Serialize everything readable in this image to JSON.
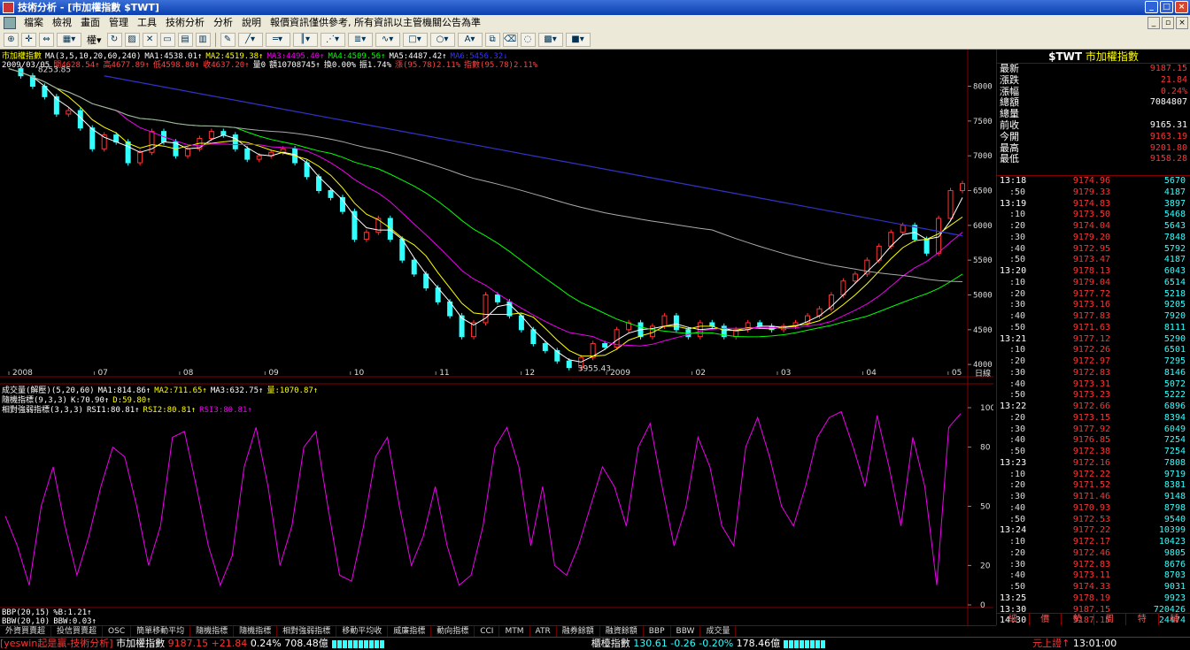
{
  "window": {
    "title": "技術分析 - [市加權指數 $TWT]"
  },
  "menu": [
    "檔案",
    "檢視",
    "畫面",
    "管理",
    "工具",
    "技術分析",
    "分析",
    "說明",
    "報價資訊僅供參考, 所有資訊以主管機關公告為準"
  ],
  "toolbar": {
    "weight_label": "權"
  },
  "info": {
    "line1": [
      {
        "t": "市加權指數",
        "c": "#ff0"
      },
      {
        "t": "MA(3,5,10,20,60,240)",
        "c": "#fff"
      },
      {
        "t": "MA1:4538.01↑",
        "c": "#fff"
      },
      {
        "t": "MA2:4519.38↑",
        "c": "#ff0"
      },
      {
        "t": "MA3:4495.40↑",
        "c": "#e0e"
      },
      {
        "t": "MA4:4509.56↑",
        "c": "#0f0"
      },
      {
        "t": "MA5:4487.42↑",
        "c": "#fff"
      },
      {
        "t": "MA6:5456.32↓",
        "c": "#33f"
      }
    ],
    "line2": [
      {
        "t": "2009/03/05",
        "c": "#fff"
      },
      {
        "t": "開4628.54↑",
        "c": "#f44"
      },
      {
        "t": "高4677.89↑",
        "c": "#f44"
      },
      {
        "t": "低4598.80↑",
        "c": "#f44"
      },
      {
        "t": "收4637.20↑",
        "c": "#f44"
      },
      {
        "t": "量0",
        "c": "#fff"
      },
      {
        "t": "額10708745↑",
        "c": "#fff"
      },
      {
        "t": "換0.00%",
        "c": "#fff"
      },
      {
        "t": "振1.74%",
        "c": "#fff"
      },
      {
        "t": "漲(95.78)2.11%",
        "c": "#f44"
      },
      {
        "t": "指數(95.78)2.11%",
        "c": "#f44"
      }
    ],
    "vol_line": [
      {
        "t": "成交量(解壓)(5,20,60)",
        "c": "#fff"
      },
      {
        "t": "MA1:814.86↑",
        "c": "#fff"
      },
      {
        "t": "MA2:711.65↑",
        "c": "#ff0"
      },
      {
        "t": "MA3:632.75↑",
        "c": "#fff"
      },
      {
        "t": "量:1070.87↑",
        "c": "#ff0"
      }
    ],
    "kd_line": [
      {
        "t": "隨機指標(9,3,3)",
        "c": "#fff"
      },
      {
        "t": "K:70.90↑",
        "c": "#fff"
      },
      {
        "t": "D:59.80↑",
        "c": "#ff0"
      }
    ],
    "rsi_line": [
      {
        "t": "相對強弱指標(3,3,3)",
        "c": "#fff"
      },
      {
        "t": "RSI1:80.81↑",
        "c": "#fff"
      },
      {
        "t": "RSI2:80.81↑",
        "c": "#ff0"
      },
      {
        "t": "RSI3:80.81↑",
        "c": "#e0e"
      }
    ],
    "bb_line1": [
      {
        "t": "BBP(20,15)",
        "c": "#fff"
      },
      {
        "t": "%B:1.21↑",
        "c": "#fff"
      }
    ],
    "bb_line2": [
      {
        "t": "BBW(20,10)",
        "c": "#fff"
      },
      {
        "t": "BBW:0.03↑",
        "c": "#fff"
      }
    ]
  },
  "chart_data": [
    {
      "type": "candlestick",
      "x_labels": [
        "2008",
        "07",
        "08",
        "09",
        "10",
        "11",
        "12",
        "2009",
        "02",
        "03",
        "04",
        "05"
      ],
      "y_ticks": [
        4000,
        4500,
        5000,
        5500,
        6000,
        6500,
        7000,
        7500,
        8000
      ],
      "ylim": [
        3900,
        8350
      ],
      "annotations": [
        {
          "text": "8253.85"
        },
        {
          "text": "3955.43"
        }
      ],
      "x_axis_right_label": "日線",
      "price_path": [
        8253,
        8150,
        8000,
        7850,
        7600,
        7650,
        7400,
        7100,
        7300,
        7200,
        6900,
        7050,
        7350,
        7200,
        7000,
        7100,
        7250,
        7350,
        7300,
        7100,
        6950,
        7000,
        7050,
        7100,
        6900,
        6700,
        6500,
        6400,
        6200,
        5800,
        5900,
        6100,
        5800,
        5500,
        5300,
        5100,
        4900,
        4700,
        4400,
        4600,
        5000,
        4900,
        4700,
        4500,
        4300,
        4200,
        4050,
        3955,
        4100,
        4300,
        4250,
        4500,
        4600,
        4400,
        4550,
        4700,
        4500,
        4400,
        4600,
        4550,
        4400,
        4500,
        4600,
        4550,
        4500,
        4550,
        4600,
        4700,
        4800,
        5000,
        5200,
        5300,
        5500,
        5700,
        5900,
        6000,
        5800,
        5600,
        6100,
        6500,
        6600
      ]
    },
    {
      "type": "line",
      "title": "RSI",
      "y_ticks": [
        0,
        20,
        50,
        80,
        100
      ],
      "ylim": [
        0,
        100
      ],
      "values": [
        45,
        30,
        10,
        50,
        70,
        40,
        15,
        35,
        60,
        80,
        75,
        50,
        20,
        40,
        85,
        88,
        60,
        30,
        10,
        25,
        70,
        90,
        60,
        20,
        40,
        80,
        88,
        50,
        15,
        12,
        40,
        75,
        85,
        50,
        20,
        35,
        60,
        30,
        10,
        15,
        40,
        80,
        90,
        70,
        30,
        60,
        20,
        15,
        30,
        50,
        70,
        60,
        40,
        80,
        92,
        60,
        30,
        50,
        85,
        70,
        40,
        30,
        80,
        95,
        75,
        50,
        40,
        60,
        85,
        95,
        98,
        80,
        60,
        96,
        70,
        40,
        85,
        60,
        10,
        90,
        97
      ]
    }
  ],
  "quote": {
    "code": "$TWT",
    "name": "市加權指數",
    "rows": [
      {
        "label": "最新",
        "value": "9187.15",
        "white": false
      },
      {
        "label": "漲跌",
        "value": "21.84",
        "white": false
      },
      {
        "label": "漲幅",
        "value": "0.24%",
        "white": false
      },
      {
        "label": "總額",
        "value": "7084807",
        "white": true
      },
      {
        "label": "總量",
        "value": "",
        "white": true
      },
      {
        "label": "前收",
        "value": "9165.31",
        "white": true
      },
      {
        "label": "今開",
        "value": "9163.19",
        "white": false
      },
      {
        "label": "最高",
        "value": "9201.80",
        "white": false
      },
      {
        "label": "最低",
        "value": "9158.28",
        "white": false
      }
    ]
  },
  "ticks": [
    {
      "t": "13:18",
      "p": "9174.96",
      "v": "5670",
      "main": true
    },
    {
      "t": ":50",
      "p": "9179.33",
      "v": "4187",
      "main": false
    },
    {
      "t": "13:19",
      "p": "9174.83",
      "v": "3897",
      "main": true
    },
    {
      "t": ":10",
      "p": "9173.50",
      "v": "5468",
      "main": false
    },
    {
      "t": ":20",
      "p": "9174.04",
      "v": "5643",
      "main": false
    },
    {
      "t": ":30",
      "p": "9179.20",
      "v": "7848",
      "main": false
    },
    {
      "t": ":40",
      "p": "9172.95",
      "v": "5792",
      "main": false
    },
    {
      "t": ":50",
      "p": "9173.47",
      "v": "4187",
      "main": false
    },
    {
      "t": "13:20",
      "p": "9178.13",
      "v": "6043",
      "main": true
    },
    {
      "t": ":10",
      "p": "9179.04",
      "v": "6514",
      "main": false
    },
    {
      "t": ":20",
      "p": "9177.72",
      "v": "5218",
      "main": false
    },
    {
      "t": ":30",
      "p": "9173.16",
      "v": "9205",
      "main": false
    },
    {
      "t": ":40",
      "p": "9177.83",
      "v": "7920",
      "main": false
    },
    {
      "t": ":50",
      "p": "9171.63",
      "v": "8111",
      "main": false
    },
    {
      "t": "13:21",
      "p": "9177.12",
      "v": "5290",
      "main": true
    },
    {
      "t": ":10",
      "p": "9172.26",
      "v": "6501",
      "main": false
    },
    {
      "t": ":20",
      "p": "9172.97",
      "v": "7295",
      "main": false
    },
    {
      "t": ":30",
      "p": "9172.83",
      "v": "8146",
      "main": false
    },
    {
      "t": ":40",
      "p": "9173.31",
      "v": "5072",
      "main": false
    },
    {
      "t": ":50",
      "p": "9173.23",
      "v": "5222",
      "main": false
    },
    {
      "t": "13:22",
      "p": "9172.66",
      "v": "6896",
      "main": true
    },
    {
      "t": ":20",
      "p": "9173.15",
      "v": "8394",
      "main": false
    },
    {
      "t": ":30",
      "p": "9177.92",
      "v": "6049",
      "main": false
    },
    {
      "t": ":40",
      "p": "9176.85",
      "v": "7254",
      "main": false
    },
    {
      "t": ":50",
      "p": "9172.38",
      "v": "7254",
      "main": false
    },
    {
      "t": "13:23",
      "p": "9172.16",
      "v": "7808",
      "main": true
    },
    {
      "t": ":10",
      "p": "9172.22",
      "v": "9719",
      "main": false
    },
    {
      "t": ":20",
      "p": "9171.52",
      "v": "8381",
      "main": false
    },
    {
      "t": ":30",
      "p": "9171.46",
      "v": "9148",
      "main": false
    },
    {
      "t": ":40",
      "p": "9170.93",
      "v": "8798",
      "main": false
    },
    {
      "t": ":50",
      "p": "9172.53",
      "v": "9540",
      "main": false
    },
    {
      "t": "13:24",
      "p": "9177.22",
      "v": "10399",
      "main": true
    },
    {
      "t": ":10",
      "p": "9172.17",
      "v": "10423",
      "main": false
    },
    {
      "t": ":20",
      "p": "9172.46",
      "v": "9805",
      "main": false
    },
    {
      "t": ":30",
      "p": "9172.83",
      "v": "8676",
      "main": false
    },
    {
      "t": ":40",
      "p": "9173.11",
      "v": "8703",
      "main": false
    },
    {
      "t": ":50",
      "p": "9174.33",
      "v": "9031",
      "main": false
    },
    {
      "t": "13:25",
      "p": "9178.19",
      "v": "9923",
      "main": true
    },
    {
      "t": "13:30",
      "p": "9187.15",
      "v": "720426",
      "main": true
    },
    {
      "t": "14:30",
      "p": "9187.15",
      "v": "24474",
      "main": true
    }
  ],
  "right_tabs": [
    "細",
    "價",
    "勢",
    "周",
    "特",
    "輔"
  ],
  "indicator_tabs": [
    "外資買賣超",
    "投信買賣超",
    "OSC",
    "簡單移動平均",
    "隨機指標",
    "隨機指標",
    "相對強弱指標",
    "移動平均收",
    "威廉指標",
    "動向指標",
    "CCI",
    "MTM",
    "ATR",
    "融券餘額",
    "融資餘額",
    "BBP",
    "BBW",
    "成交量"
  ],
  "status": {
    "brand": "[yeswin起是贏-技術分析]",
    "idx1_name": "市加權指數",
    "idx1_val": "9187.15",
    "idx1_chg": "+21.84",
    "idx1_pct": "0.24%",
    "idx1_amt": "708.48億",
    "idx2_name": "櫃檯指數",
    "idx2_val": "130.61",
    "idx2_chg": "-0.26",
    "idx2_pct": "-0.20%",
    "idx2_amt": "178.46億",
    "status_text": "元上證↑",
    "clock": "13:01:00"
  }
}
